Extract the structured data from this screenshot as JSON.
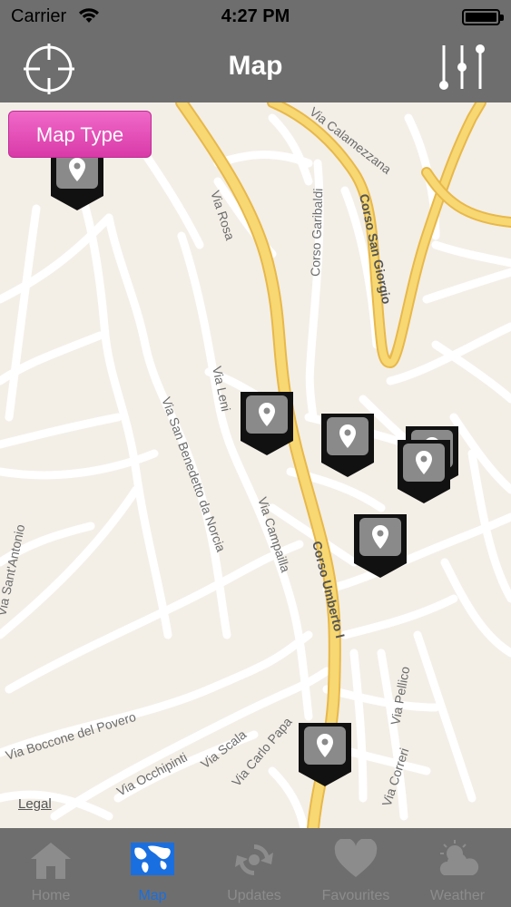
{
  "status_bar": {
    "carrier": "Carrier",
    "time": "4:27 PM"
  },
  "nav": {
    "title": "Map",
    "left_icon": "locate-crosshair-icon",
    "right_icon": "filter-sliders-icon"
  },
  "map": {
    "map_type_label": "Map Type",
    "legal_label": "Legal",
    "street_labels": {
      "via_calamezzana": "Via Calamezzana",
      "corso_garibaldi": "Corso Garibaldi",
      "corso_san_giorgio": "Corso San Giorgio",
      "via_rosa": "Via Rosa",
      "via_leni": "Via Leni",
      "via_san_benedetto": "Via San Benedetto da Norcia",
      "via_sant_antonio": "Via Sant'Antonio",
      "via_campailla": "Via Campailla",
      "corso_umberto": "Corso Umberto I",
      "via_pellico": "Via Pellico",
      "via_boccone": "Via Boccone del Povero",
      "via_occhipinti": "Via Occhipinti",
      "via_scala": "Via Scala",
      "via_carlo_papa": "Via Carlo Papa",
      "via_correri": "Via Correri"
    },
    "pin_icon": "map-pin-icon",
    "pin_count": 7
  },
  "tabs": [
    {
      "label": "Home",
      "icon": "home-icon",
      "active": false
    },
    {
      "label": "Map",
      "icon": "world-map-icon",
      "active": true
    },
    {
      "label": "Updates",
      "icon": "refresh-icon",
      "active": false
    },
    {
      "label": "Favourites",
      "icon": "heart-icon",
      "active": false
    },
    {
      "label": "Weather",
      "icon": "weather-icon",
      "active": false
    }
  ],
  "colors": {
    "bar": "#6e6e6e",
    "accent": "#1a6fe0",
    "map_type": "#e24db8",
    "major_road": "#f5cf6a"
  }
}
